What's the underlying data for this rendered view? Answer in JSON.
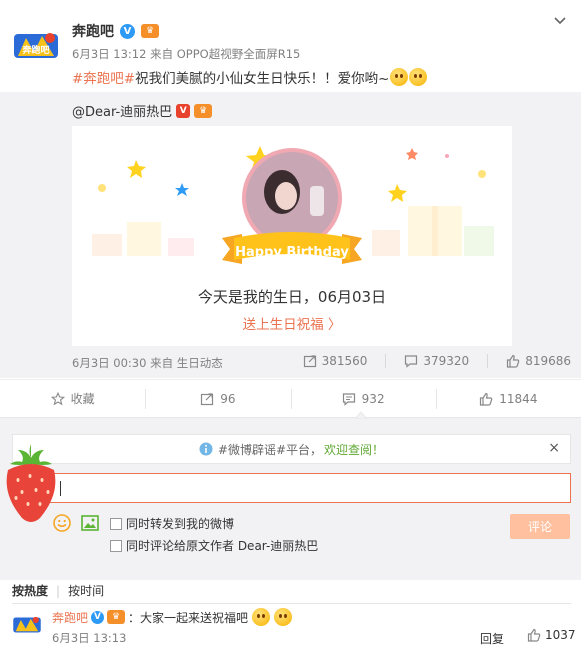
{
  "post": {
    "author": "奔跑吧",
    "verified_badge": "V",
    "meta": "6月3日 13:12 来自 OPPO超视野全面屏R15",
    "hashtag": "#奔跑吧#",
    "text": " 祝我们美腻的小仙女生日快乐！！爱你哟~",
    "logo_text": "奔跑吧"
  },
  "repost": {
    "author": "@Dear-迪丽热巴",
    "card_banner": "Happy Birthday",
    "card_title": "今天是我的生日，06月03日",
    "card_link": "送上生日祝福 〉",
    "meta": "6月3日 00:30 来自 生日动态",
    "reposts": "381560",
    "comments": "379320",
    "likes": "819686"
  },
  "actions": {
    "favorite": "收藏",
    "repost": "96",
    "comment": "932",
    "like": "11844"
  },
  "comment_box": {
    "notice_tag": "#微博辟谣#平台，",
    "notice_link": "欢迎查阅！",
    "close": "×",
    "option1": "同时转发到我的微博",
    "option2": "同时评论给原文作者 Dear-迪丽热巴",
    "submit": "评论"
  },
  "sort": {
    "hot": "按热度",
    "time": "按时间"
  },
  "comments": [
    {
      "author": "奔跑吧",
      "text": "：大家一起来送祝福吧",
      "time": "6月3日 13:13",
      "reply": "回复",
      "likes": "1037"
    }
  ],
  "colors": {
    "accent": "#eb7350",
    "verified": "#2d9af6",
    "muted": "#808080",
    "panel": "#f2f2f5"
  }
}
